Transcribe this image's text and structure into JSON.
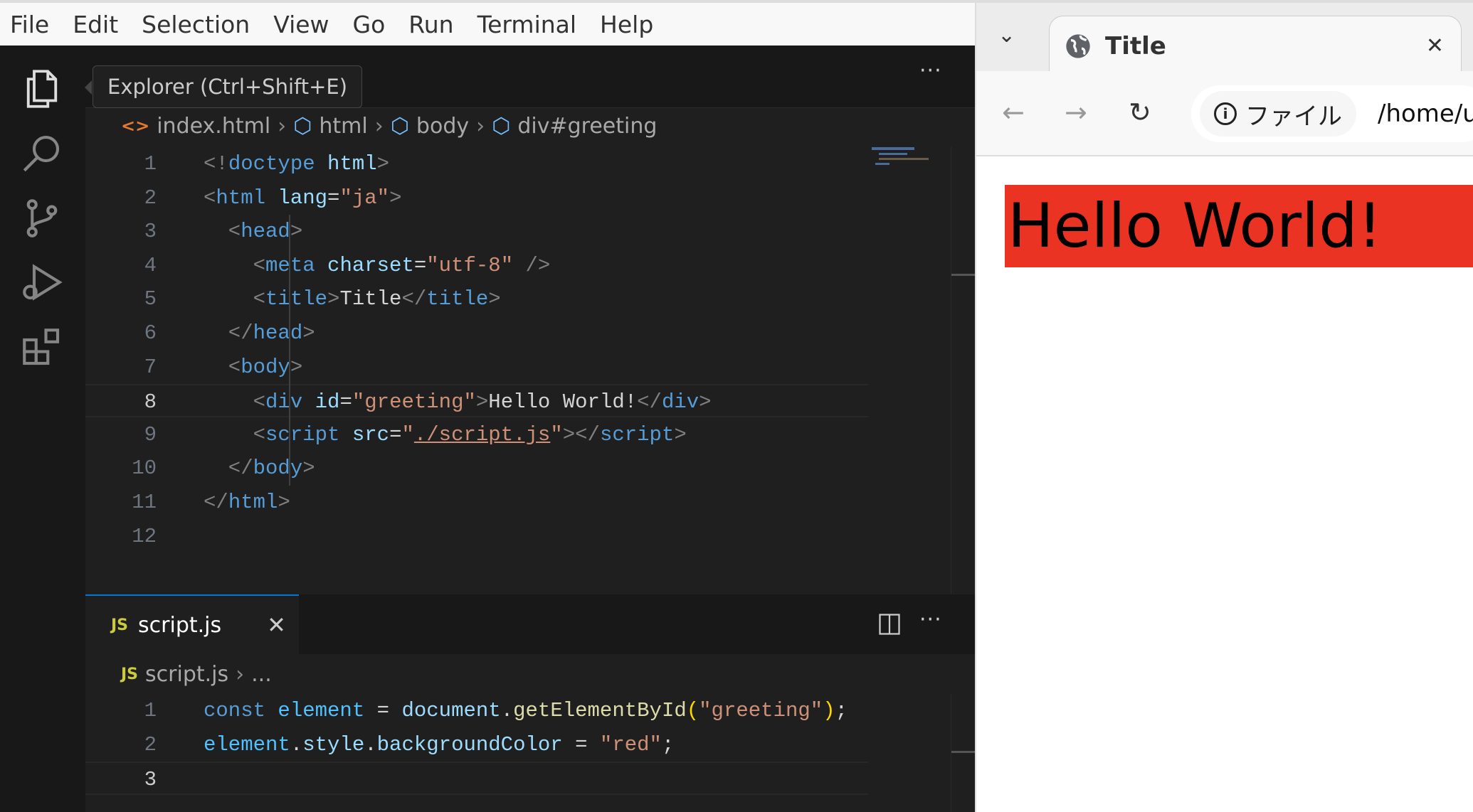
{
  "vscode": {
    "menu": [
      "File",
      "Edit",
      "Selection",
      "View",
      "Go",
      "Run",
      "Terminal",
      "Help"
    ],
    "tooltip": "Explorer (Ctrl+Shift+E)",
    "more": "···",
    "editor1": {
      "breadcrumb": [
        "index.html",
        "html",
        "body",
        "div#greeting"
      ],
      "current_line": 8,
      "lines": [
        [
          [
            "<!",
            "#808080"
          ],
          [
            "doctype",
            "#569cd6"
          ],
          [
            " html",
            "#9cdcfe"
          ],
          [
            ">",
            "#808080"
          ]
        ],
        [
          [
            "<",
            "#808080"
          ],
          [
            "html",
            "#569cd6"
          ],
          [
            " lang",
            "#9cdcfe"
          ],
          [
            "=",
            "#d4d4d4"
          ],
          [
            "\"ja\"",
            "#ce9178"
          ],
          [
            ">",
            "#808080"
          ]
        ],
        [
          [
            "  <",
            "#808080"
          ],
          [
            "head",
            "#569cd6"
          ],
          [
            ">",
            "#808080"
          ]
        ],
        [
          [
            "    <",
            "#808080"
          ],
          [
            "meta",
            "#569cd6"
          ],
          [
            " charset",
            "#9cdcfe"
          ],
          [
            "=",
            "#d4d4d4"
          ],
          [
            "\"utf-8\"",
            "#ce9178"
          ],
          [
            " />",
            "#808080"
          ]
        ],
        [
          [
            "    <",
            "#808080"
          ],
          [
            "title",
            "#569cd6"
          ],
          [
            ">",
            "#808080"
          ],
          [
            "Title",
            "#d4d4d4"
          ],
          [
            "</",
            "#808080"
          ],
          [
            "title",
            "#569cd6"
          ],
          [
            ">",
            "#808080"
          ]
        ],
        [
          [
            "  </",
            "#808080"
          ],
          [
            "head",
            "#569cd6"
          ],
          [
            ">",
            "#808080"
          ]
        ],
        [
          [
            "  <",
            "#808080"
          ],
          [
            "body",
            "#569cd6"
          ],
          [
            ">",
            "#808080"
          ]
        ],
        [
          [
            "    <",
            "#808080"
          ],
          [
            "div",
            "#569cd6"
          ],
          [
            " id",
            "#9cdcfe"
          ],
          [
            "=",
            "#d4d4d4"
          ],
          [
            "\"greeting\"",
            "#ce9178"
          ],
          [
            ">",
            "#808080"
          ],
          [
            "Hello World!",
            "#d4d4d4"
          ],
          [
            "</",
            "#808080"
          ],
          [
            "div",
            "#569cd6"
          ],
          [
            ">",
            "#808080"
          ]
        ],
        [
          [
            "    <",
            "#808080"
          ],
          [
            "script",
            "#569cd6"
          ],
          [
            " src",
            "#9cdcfe"
          ],
          [
            "=",
            "#d4d4d4"
          ],
          [
            "\"",
            "#ce9178"
          ],
          [
            "./script.js",
            "#ce9178"
          ],
          [
            "\"",
            "#ce9178"
          ],
          [
            "></",
            "#808080"
          ],
          [
            "script",
            "#569cd6"
          ],
          [
            ">",
            "#808080"
          ]
        ],
        [
          [
            "  </",
            "#808080"
          ],
          [
            "body",
            "#569cd6"
          ],
          [
            ">",
            "#808080"
          ]
        ],
        [
          [
            "</",
            "#808080"
          ],
          [
            "html",
            "#569cd6"
          ],
          [
            ">",
            "#808080"
          ]
        ],
        []
      ]
    },
    "editor2": {
      "tab_label": "script.js",
      "tab_icon": "JS",
      "breadcrumb": [
        "script.js",
        "..."
      ],
      "lines": [
        [
          [
            "const",
            "#569cd6"
          ],
          [
            " element",
            "#4fc1ff"
          ],
          [
            " = ",
            "#d4d4d4"
          ],
          [
            "document",
            "#9cdcfe"
          ],
          [
            ".",
            "#d4d4d4"
          ],
          [
            "getElementById",
            "#dcdcaa"
          ],
          [
            "(",
            "#ffd700"
          ],
          [
            "\"greeting\"",
            "#ce9178"
          ],
          [
            ")",
            "#ffd700"
          ],
          [
            ";",
            "#d4d4d4"
          ]
        ],
        [
          [
            "element",
            "#4fc1ff"
          ],
          [
            ".",
            "#d4d4d4"
          ],
          [
            "style",
            "#9cdcfe"
          ],
          [
            ".",
            "#d4d4d4"
          ],
          [
            "backgroundColor",
            "#9cdcfe"
          ],
          [
            " = ",
            "#d4d4d4"
          ],
          [
            "\"red\"",
            "#ce9178"
          ],
          [
            ";",
            "#d4d4d4"
          ]
        ],
        []
      ]
    }
  },
  "browser": {
    "tab_title": "Title",
    "chip_label": "ファイル",
    "url": "/home/u",
    "content_text": "Hello World!",
    "content_bg": "#ea3323"
  }
}
